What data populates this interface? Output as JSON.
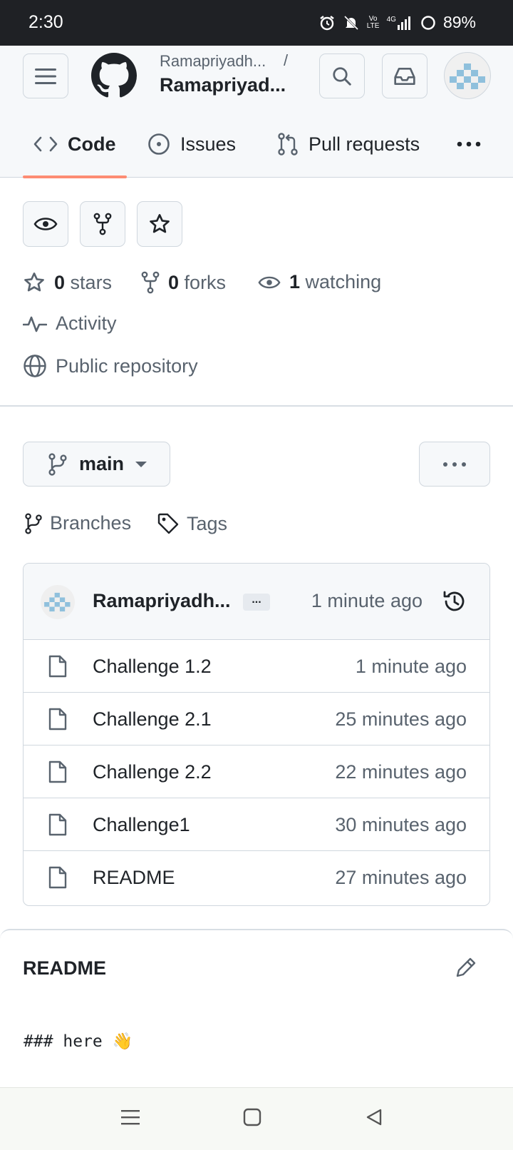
{
  "status_bar": {
    "time": "2:30",
    "battery": "89%",
    "network": "4G",
    "volte": "Vo LTE"
  },
  "header": {
    "owner": "Ramapriyadh...",
    "separator": "/",
    "repo": "Ramapriyad..."
  },
  "tabs": [
    {
      "label": "Code",
      "active": true
    },
    {
      "label": "Issues"
    },
    {
      "label": "Pull requests"
    }
  ],
  "stats": {
    "stars_count": "0",
    "stars_label": "stars",
    "forks_count": "0",
    "forks_label": "forks",
    "watching_count": "1",
    "watching_label": "watching",
    "activity_label": "Activity",
    "visibility_label": "Public repository"
  },
  "branch": {
    "name": "main",
    "branches_label": "Branches",
    "tags_label": "Tags"
  },
  "latest_commit": {
    "author": "Ramapriyadh...",
    "message_badge": "...",
    "time": "1 minute ago"
  },
  "files": [
    {
      "name": "Challenge 1.2",
      "time": "1 minute ago"
    },
    {
      "name": "Challenge 2.1",
      "time": "25 minutes ago"
    },
    {
      "name": "Challenge 2.2",
      "time": "22 minutes ago"
    },
    {
      "name": "Challenge1",
      "time": "30 minutes ago"
    },
    {
      "name": "README",
      "time": "27 minutes ago"
    }
  ],
  "readme": {
    "title": "README",
    "content": "### here 👋"
  },
  "colors": {
    "accent_underline": "#fd8c73",
    "status_bar_bg": "#1f2125",
    "avatar_identicon": "#8fc0dc"
  }
}
